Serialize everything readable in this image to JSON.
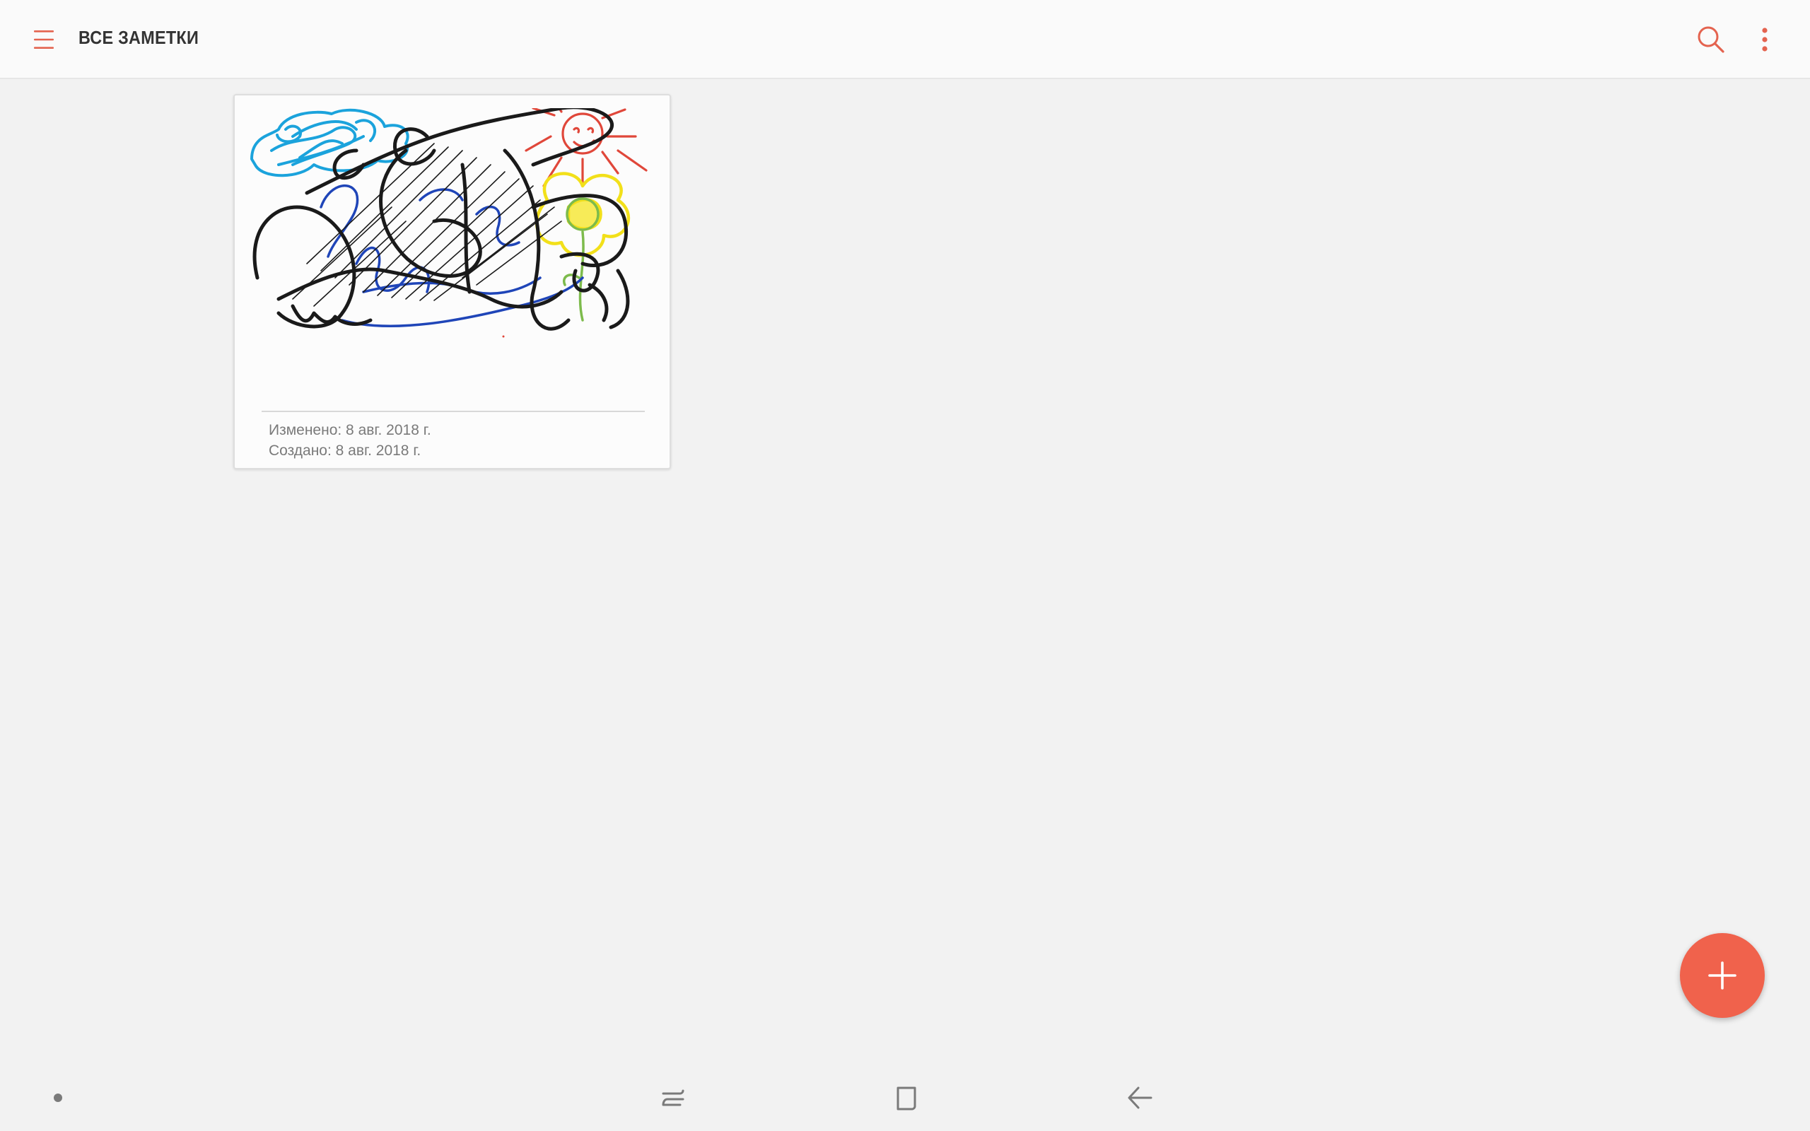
{
  "header": {
    "title": "ВСЕ ЗАМЕТКИ",
    "menu_icon": "hamburger-menu-icon",
    "search_icon": "search-icon",
    "more_icon": "more-vertical-icon"
  },
  "notes": [
    {
      "thumbnail": "handwritten-drawing-thumbnail",
      "modified": "Изменено: 8 авг. 2018 г.",
      "created": "Создано: 8 авг. 2018 г."
    }
  ],
  "fab": {
    "icon": "plus-icon"
  },
  "navigation_bar": {
    "recents_icon": "recent-apps-icon",
    "home_icon": "home-icon",
    "back_icon": "back-arrow-icon"
  },
  "colors": {
    "accent": "#f0624c",
    "icon_accent": "#e4634f",
    "background": "#f2f2f2",
    "appbar": "#fafafa",
    "title_text": "#333333",
    "meta_text": "#7a7a7a",
    "nav_icon": "#7a7a7a"
  }
}
